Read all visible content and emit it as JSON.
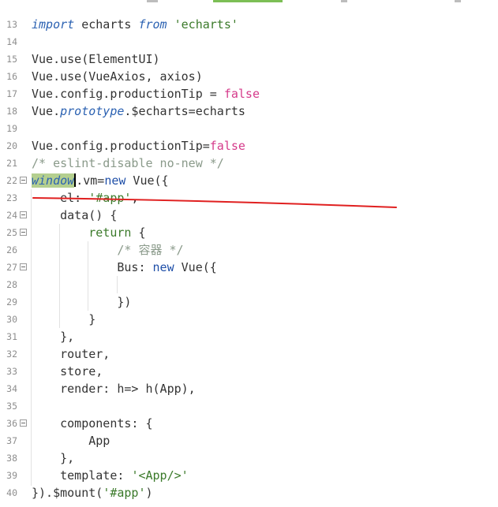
{
  "editor": {
    "colors": {
      "background": "#ffffff",
      "highlight": "#b4cf8f",
      "strike": "#e02020",
      "keyword": "#2c62b2",
      "string": "#3b7a2a",
      "boolean": "#d53a8a",
      "comment": "#8a9a8a"
    },
    "lines": [
      {
        "num": "13"
      },
      {
        "num": "14"
      },
      {
        "num": "15"
      },
      {
        "num": "16"
      },
      {
        "num": "17"
      },
      {
        "num": "18"
      },
      {
        "num": "19"
      },
      {
        "num": "20"
      },
      {
        "num": "21"
      },
      {
        "num": "22"
      },
      {
        "num": "23"
      },
      {
        "num": "24"
      },
      {
        "num": "25"
      },
      {
        "num": "26"
      },
      {
        "num": "27"
      },
      {
        "num": "28"
      },
      {
        "num": "29"
      },
      {
        "num": "30"
      },
      {
        "num": "31"
      },
      {
        "num": "32"
      },
      {
        "num": "33"
      },
      {
        "num": "34"
      },
      {
        "num": "35"
      },
      {
        "num": "36"
      },
      {
        "num": "37"
      },
      {
        "num": "38"
      },
      {
        "num": "39"
      },
      {
        "num": "40"
      }
    ],
    "tokens": {
      "l13_import": "import",
      "l13_echarts": " echarts ",
      "l13_from": "from",
      "l13_space": " ",
      "l13_str": "'echarts'",
      "l15_code": "Vue.use(ElementUI)",
      "l16_code": "Vue.use(VueAxios, axios)",
      "l17_code": "Vue.config.productionTip = ",
      "l17_false": "false",
      "l18_vue": "Vue.",
      "l18_proto": "prototype",
      "l18_rest": ".$echarts=echarts",
      "l20_code": "Vue.config.productionTip=",
      "l20_false": "false",
      "l21_comment": "/* eslint-disable no-new */",
      "l22_window": "window",
      "l22_rest": ".vm=",
      "l22_new": "new",
      "l22_end": " Vue({",
      "l23_indent": "    ",
      "l23_key": "el: ",
      "l23_str": "'#app'",
      "l23_end": ",",
      "l24_code": "    data() {",
      "l25_indent": "        ",
      "l25_return": "return",
      "l25_end": " {",
      "l26_indent": "            ",
      "l26_comment": "/* 容器 */",
      "l27_indent": "            ",
      "l27_key": "Bus: ",
      "l27_new": "new",
      "l27_end": " Vue({",
      "l28_code": "",
      "l29_code": "            })",
      "l30_code": "        }",
      "l31_code": "    },",
      "l32_code": "    router,",
      "l33_code": "    store,",
      "l34_code": "    render: h=> h(App),",
      "l35_code": "",
      "l36_code": "    components: {",
      "l37_code": "        App",
      "l38_code": "    },",
      "l39_key": "    template: ",
      "l39_str": "'<App/>'",
      "l40_start": "}).$mount(",
      "l40_str": "'#app'",
      "l40_end": ")"
    }
  }
}
